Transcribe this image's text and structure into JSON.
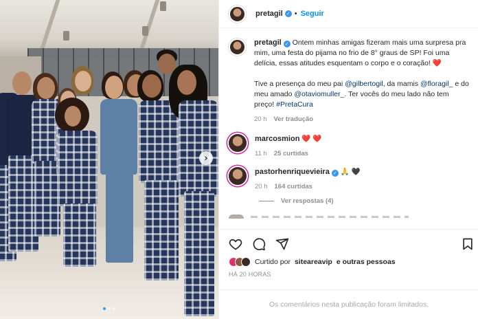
{
  "post": {
    "username": "pretagil",
    "follow_label": "Seguir",
    "separator": "•",
    "verified_mark": "✓"
  },
  "caption": {
    "username": "pretagil",
    "text_1": "Ontem minhas amigas fizeram mais uma surpresa pra mim, uma festa do pijama no frio de 8° graus de SP! Foi uma delícia, essas atitudes esquentam o corpo e o coração!",
    "heart": "❤️",
    "text_2a": "Tive a presença do meu pai",
    "mention_1": "@gilbertogil",
    "text_2b": ", da mamis",
    "mention_2": "@floragil_",
    "text_2c": "e do meu amado",
    "mention_3": "@otaviomuller_",
    "text_2d": ". Ter vocês do meu lado não tem preço!",
    "hashtag": "#PretaCura",
    "time": "20 h",
    "translation_label": "Ver tradução"
  },
  "comments": [
    {
      "username": "marcosmion",
      "text": "❤️ ❤️",
      "time": "11 h",
      "likes": "25 curtidas"
    },
    {
      "username": "pastorhenriquevieira",
      "text_pray": "🙏",
      "text_heart": "🖤",
      "time": "20 h",
      "likes": "164 curtidas",
      "view_replies": "Ver respostas (4)"
    }
  ],
  "likes_summary": {
    "prefix": "Curtido por",
    "user": "siteareavip",
    "suffix": "e outras pessoas"
  },
  "post_time": "HÁ 20 HORAS",
  "limited_notice": "Os comentários nesta publicação foram limitados.",
  "icons": {
    "like": "heart-icon",
    "comment": "comment-icon",
    "share": "send-icon",
    "save": "bookmark-icon",
    "next": "chevron-right-icon"
  },
  "colors": {
    "accent_blue": "#0095f6",
    "verified_blue": "#3897f0",
    "mention_blue": "#00376b",
    "heart_red": "#ed4956",
    "muted_gray": "#8e8e8e"
  },
  "carousel": {
    "current": 1,
    "total": 3
  }
}
